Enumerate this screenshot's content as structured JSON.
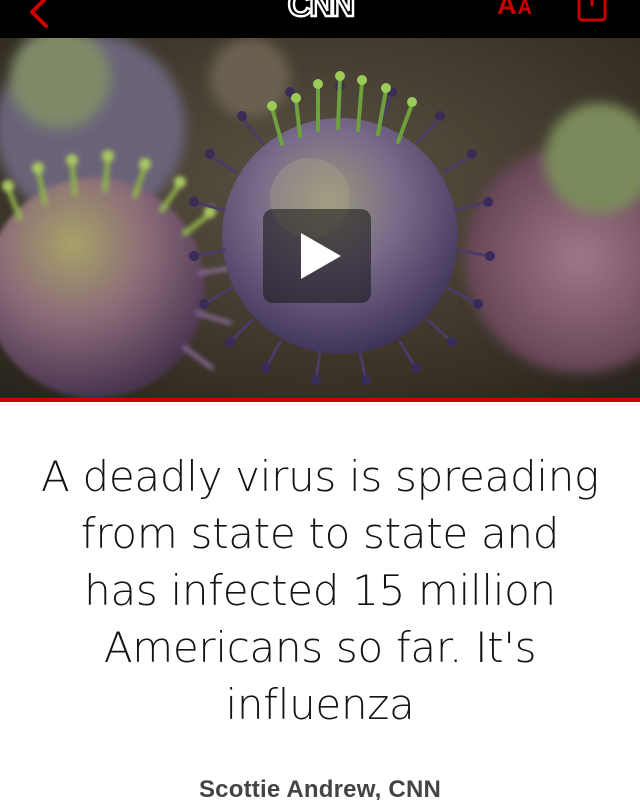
{
  "colors": {
    "accent": "#cc0000",
    "topbar_bg": "#000000",
    "headline_text": "#141414",
    "byline_text": "#444444"
  },
  "topbar": {
    "back_icon": "chevron-left-icon",
    "logo_text": "CNN",
    "text_size_label_large": "A",
    "text_size_label_small": "A",
    "share_icon": "share-icon"
  },
  "hero": {
    "media_type": "video",
    "play_icon": "play-icon"
  },
  "article": {
    "headline": "A deadly virus is spreading from state to state and has infected 15 million Americans so far. It's influenza",
    "byline": "Scottie Andrew, CNN"
  }
}
